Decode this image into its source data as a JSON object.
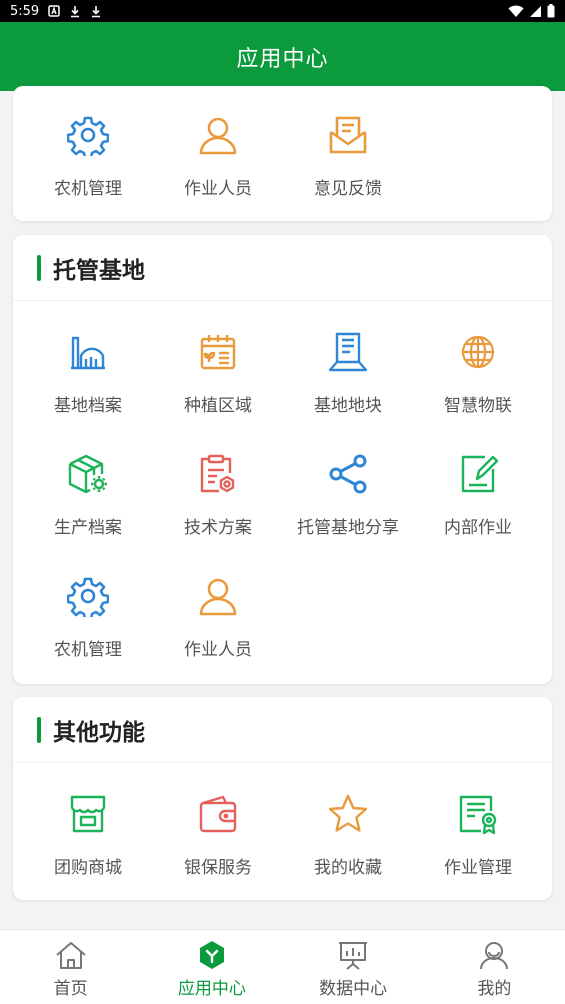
{
  "status_bar": {
    "time": "5:59"
  },
  "header": {
    "title": "应用中心"
  },
  "top_card": {
    "items": [
      {
        "label": "农机管理",
        "icon": "gear-icon"
      },
      {
        "label": "作业人员",
        "icon": "person-icon"
      },
      {
        "label": "意见反馈",
        "icon": "feedback-envelope-icon"
      }
    ]
  },
  "hosting_base": {
    "title": "托管基地",
    "items": [
      {
        "label": "基地档案",
        "icon": "factory-icon"
      },
      {
        "label": "种植区域",
        "icon": "calendar-plant-icon"
      },
      {
        "label": "基地地块",
        "icon": "document-stand-icon"
      },
      {
        "label": "智慧物联",
        "icon": "globe-icon"
      },
      {
        "label": "生产档案",
        "icon": "box-gear-icon"
      },
      {
        "label": "技术方案",
        "icon": "clipboard-gear-icon"
      },
      {
        "label": "托管基地分享",
        "icon": "share-icon"
      },
      {
        "label": "内部作业",
        "icon": "edit-icon"
      },
      {
        "label": "农机管理",
        "icon": "gear-icon"
      },
      {
        "label": "作业人员",
        "icon": "person-icon"
      }
    ]
  },
  "other_functions": {
    "title": "其他功能",
    "items": [
      {
        "label": "团购商城",
        "icon": "store-icon"
      },
      {
        "label": "银保服务",
        "icon": "wallet-icon"
      },
      {
        "label": "我的收藏",
        "icon": "star-icon"
      },
      {
        "label": "作业管理",
        "icon": "certificate-icon"
      }
    ]
  },
  "tab_bar": {
    "active": "应用中心",
    "tabs": [
      {
        "label": "首页",
        "icon": "home-icon"
      },
      {
        "label": "应用中心",
        "icon": "app-center-icon"
      },
      {
        "label": "数据中心",
        "icon": "presentation-icon"
      },
      {
        "label": "我的",
        "icon": "user-icon"
      }
    ]
  },
  "colors": {
    "brand_green": "#0b9a3c",
    "icon_blue": "#2f86d6",
    "icon_orange": "#e99a3c",
    "icon_green": "#1cb35a",
    "icon_red": "#e2625b"
  }
}
